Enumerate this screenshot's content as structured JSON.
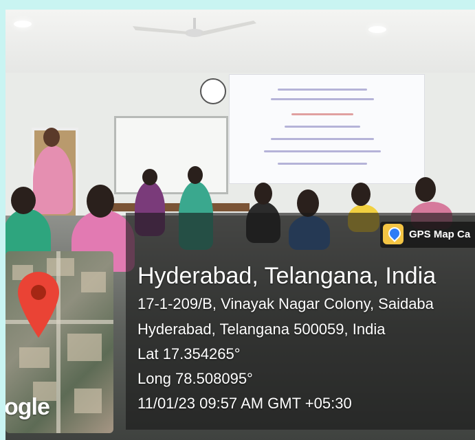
{
  "badge": {
    "app_name": "GPS Map Ca",
    "icon": "map-pin-icon"
  },
  "location": {
    "title": "Hyderabad, Telangana, India",
    "address_line1": "17-1-209/B, Vinayak Nagar Colony, Saidaba",
    "address_line2": "Hyderabad, Telangana 500059, India",
    "latitude": "Lat 17.354265°",
    "longitude": "Long 78.508095°",
    "timestamp": "11/01/23 09:57 AM GMT +05:30"
  },
  "map": {
    "logo_text": "ogle",
    "pin_color": "#ea4335"
  },
  "colors": {
    "page_background": "#c9f4f2",
    "overlay": "#191919"
  }
}
